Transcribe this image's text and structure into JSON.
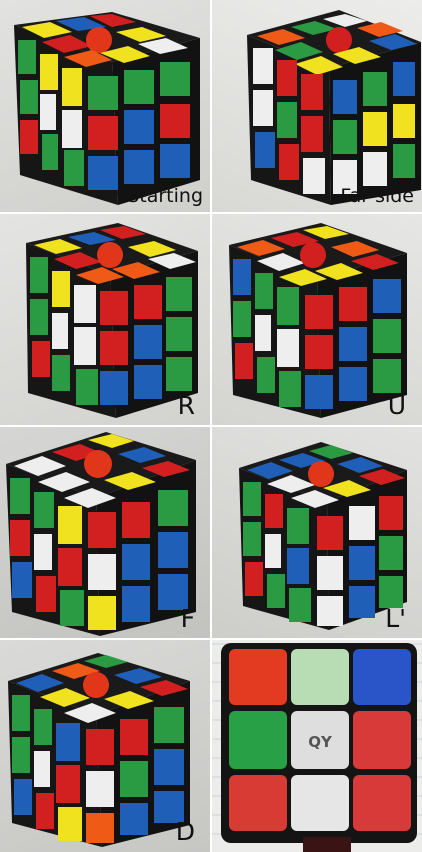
{
  "panels": [
    {
      "label": "Starting"
    },
    {
      "label": "Far side"
    },
    {
      "label": "R"
    },
    {
      "label": "U"
    },
    {
      "label": "F"
    },
    {
      "label": "L'"
    },
    {
      "label": "D"
    },
    {
      "label": ""
    }
  ],
  "cube_logo_text": "QY"
}
